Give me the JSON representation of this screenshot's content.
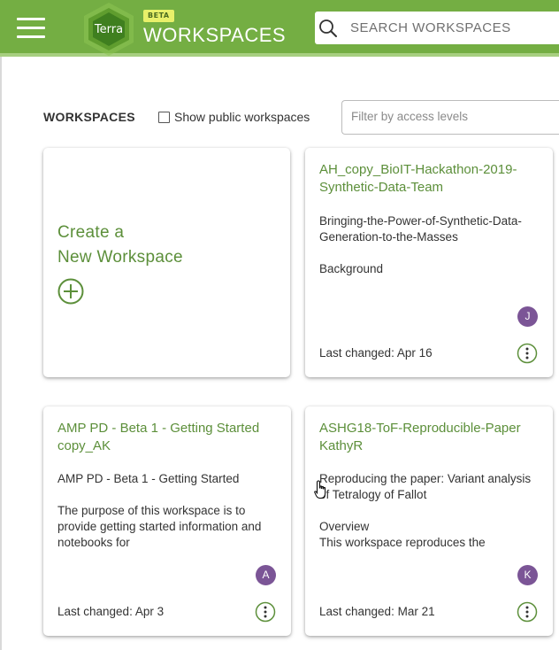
{
  "header": {
    "logo_text": "Terra",
    "beta_badge": "BETA",
    "title": "WORKSPACES",
    "search_placeholder": "SEARCH WORKSPACES",
    "brand_color": "#74ae43"
  },
  "toolbar": {
    "heading": "WORKSPACES",
    "show_public_label": "Show public workspaces",
    "show_public_checked": false,
    "filter_placeholder": "Filter by access levels"
  },
  "create_card": {
    "line1": "Create a",
    "line2": "New Workspace",
    "icon": "plus-circle-icon"
  },
  "workspaces": [
    {
      "title": "AH_copy_BioIT-Hackathon-2019-Synthetic-Data-Team",
      "subtitle": "Bringing-the-Power-of-Synthetic-Data-Generation-to-the-Masses",
      "description": "Background",
      "avatar": "J",
      "last_changed": "Last changed: Apr 16"
    },
    {
      "title": "AMP PD - Beta 1 - Getting Started copy_AK",
      "subtitle": "AMP PD - Beta 1 - Getting Started",
      "description": "The purpose of this workspace is to provide getting started information and notebooks for",
      "avatar": "A",
      "last_changed": "Last changed: Apr 3"
    },
    {
      "title": "ASHG18-ToF-Reproducible-Paper KathyR",
      "subtitle": "Reproducing the paper: Variant analysis of Tetralogy of Fallot",
      "description": "Overview\nThis workspace reproduces the",
      "avatar": "K",
      "last_changed": "Last changed: Mar 21"
    }
  ]
}
